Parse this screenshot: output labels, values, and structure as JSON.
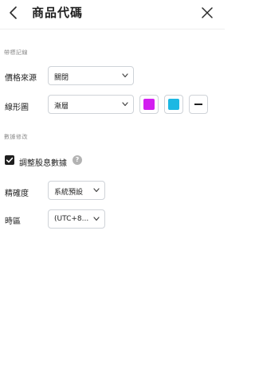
{
  "header": {
    "title": "商品代碼"
  },
  "sections": {
    "line_settings": "帶標記線",
    "data_modification": "數據修改"
  },
  "price_source": {
    "label": "價格來源",
    "value": "關閉"
  },
  "line_style": {
    "label": "線形圖",
    "value": "漸層",
    "color_1": "#d21ff0",
    "color_2": "#1cb8e3"
  },
  "adjust_dividends": {
    "label": "調整股息數據",
    "checked": true
  },
  "precision": {
    "label": "精確度",
    "value": "系統預設"
  },
  "timezone": {
    "label": "時區",
    "value": "(UTC+8..."
  },
  "icons": {
    "back": "chevron-left-icon",
    "close": "close-icon",
    "dropdown": "chevron-down-icon",
    "checkbox": "checkmark-icon",
    "help": "question-icon",
    "line_width": "horizontal-line-icon"
  }
}
